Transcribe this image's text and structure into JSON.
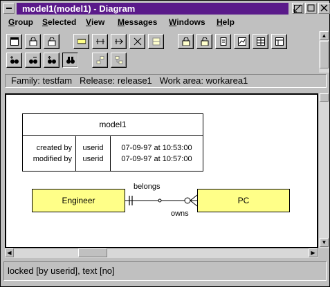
{
  "window": {
    "title": "model1(model1) - Diagram"
  },
  "menu": [
    {
      "label": "Group",
      "ul": "G",
      "rest": "roup"
    },
    {
      "label": "Selected",
      "ul": "S",
      "rest": "elected"
    },
    {
      "label": "View",
      "ul": "V",
      "rest": "iew"
    },
    {
      "label": "Messages",
      "ul": "M",
      "rest": "essages"
    },
    {
      "label": "Windows",
      "ul": "W",
      "rest": "indows"
    },
    {
      "label": "Help",
      "ul": "H",
      "rest": "elp"
    }
  ],
  "info": {
    "family_label": "Family:",
    "family_value": "testfam",
    "release_label": "Release:",
    "release_value": "release1",
    "workarea_label": "Work area:",
    "workarea_value": "workarea1"
  },
  "diagram": {
    "model_name": "model1",
    "created_label": "created by",
    "modified_label": "modified by",
    "created_user": "userid",
    "modified_user": "userid",
    "created_time": "07-09-97 at 10:53:00",
    "modified_time": "07-09-97 at 10:57:00",
    "entity_left": "Engineer",
    "entity_right": "PC",
    "relation_top": "belongs",
    "relation_bottom": "owns",
    "entity_fill": "#ffff88"
  },
  "status": {
    "text": "locked [by userid], text [no]"
  },
  "colors": {
    "title_bar": "#5a1a8a",
    "face": "#c0c0c0"
  }
}
